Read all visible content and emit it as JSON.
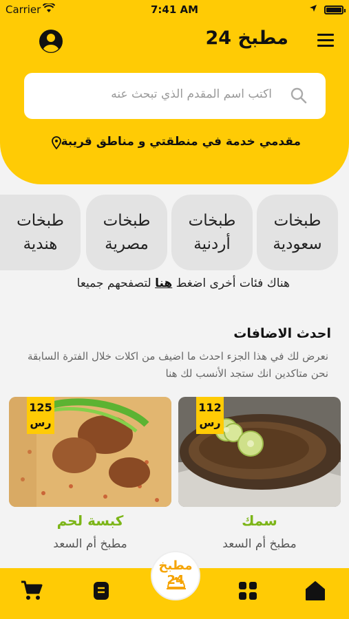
{
  "status_bar": {
    "carrier": "Carrier",
    "time": "7:41 AM"
  },
  "header": {
    "title": "مطبخ 24"
  },
  "search": {
    "placeholder": "اكتب اسم المقدم الذي تبحث عنه"
  },
  "service_area": "مقدمي خدمة في منطقتي و مناطق قريبة",
  "categories": [
    {
      "line1": "طبخات",
      "line2": "سعودية"
    },
    {
      "line1": "طبخات",
      "line2": "أردنية"
    },
    {
      "line1": "طبخات",
      "line2": "مصرية"
    },
    {
      "line1": "طبخات",
      "line2": "هندية"
    }
  ],
  "more_categories": {
    "before": "هناك فئات أخرى اضغط ",
    "link": "هنا",
    "after": " لتصفحهم جميعا"
  },
  "latest": {
    "title": "احدث الاضافات",
    "desc_line1": "نعرض لك في هذا الجزء احدث ما اضيف من اكلات خلال الفترة السابقة",
    "desc_line2": "نحن متاكدين انك ستجد الأنسب لك هنا"
  },
  "meals": [
    {
      "name": "سمك",
      "kitchen": "مطبخ أم السعد",
      "price": "112",
      "currency": "رس"
    },
    {
      "name": "كبسة لحم",
      "kitchen": "مطبخ أم السعد",
      "price": "125",
      "currency": "رس"
    }
  ],
  "tabbar": {
    "logo_text": "مطبخ 24"
  },
  "colors": {
    "brand_yellow": "#FFCB05",
    "food_name_green": "#7CB518"
  },
  "icons": [
    "user-circle-icon",
    "hamburger-menu-icon",
    "search-icon",
    "location-pin-icon",
    "home-icon",
    "grid-icon",
    "orders-icon",
    "cart-icon"
  ]
}
